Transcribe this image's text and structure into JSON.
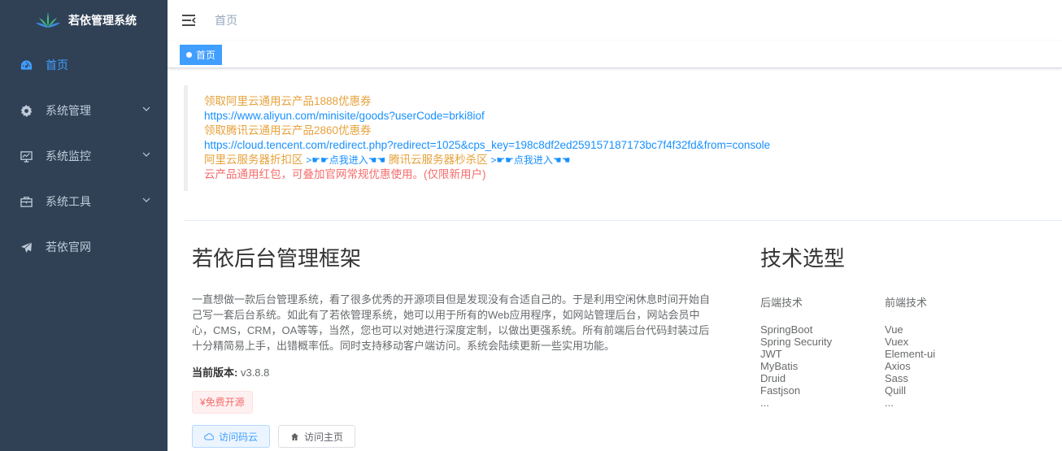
{
  "app": {
    "title": "若依管理系统"
  },
  "sidebar": {
    "items": [
      {
        "label": "首页",
        "icon": "dashboard-icon",
        "active": true
      },
      {
        "label": "系统管理",
        "icon": "gear-icon",
        "has_children": true
      },
      {
        "label": "系统监控",
        "icon": "monitor-icon",
        "has_children": true
      },
      {
        "label": "系统工具",
        "icon": "toolbox-icon",
        "has_children": true
      },
      {
        "label": "若依官网",
        "icon": "send-icon",
        "has_children": false
      }
    ]
  },
  "navbar": {
    "breadcrumb": "首页"
  },
  "tags": [
    {
      "label": "首页",
      "active": true
    }
  ],
  "promo": {
    "line1": "领取阿里云通用云产品1888优惠券",
    "line2": "https://www.aliyun.com/minisite/goods?userCode=brki8iof",
    "line3": "领取腾讯云通用云产品2860优惠券",
    "line4": "https://cloud.tencent.com/redirect.php?redirect=1025&cps_key=198c8df2ed259157187173bc7f4f32fd&from=console",
    "aliyun_label": "阿里云服务器折扣区",
    "aliyun_link": ">☛☛点我进入☚☚",
    "tencent_label": "腾讯云服务器秒杀区",
    "tencent_link": ">☛☛点我进入☚☚",
    "line6": "云产品通用红包，可叠加官网常规优惠使用。(仅限新用户)"
  },
  "intro": {
    "title": "若依后台管理框架",
    "description": "一直想做一款后台管理系统，看了很多优秀的开源项目但是发现没有合适自己的。于是利用空闲休息时间开始自己写一套后台系统。如此有了若依管理系统，她可以用于所有的Web应用程序，如网站管理后台，网站会员中心，CMS，CRM，OA等等，当然，您也可以对她进行深度定制，以做出更强系统。所有前端后台代码封装过后十分精简易上手，出错概率低。同时支持移动客户端访问。系统会陆续更新一些实用功能。",
    "version_label": "当前版本:",
    "version_value": "v3.8.8",
    "free_tag": "¥免费开源",
    "btn_gitee": "访问码云",
    "btn_home": "访问主页"
  },
  "tech": {
    "title": "技术选型",
    "backend_title": "后端技术",
    "backend": [
      "SpringBoot",
      "Spring Security",
      "JWT",
      "MyBatis",
      "Druid",
      "Fastjson",
      "..."
    ],
    "frontend_title": "前端技术",
    "frontend": [
      "Vue",
      "Vuex",
      "Element-ui",
      "Axios",
      "Sass",
      "Quill",
      "..."
    ]
  },
  "colors": {
    "sidebar_bg": "#304156",
    "accent": "#409eff"
  }
}
